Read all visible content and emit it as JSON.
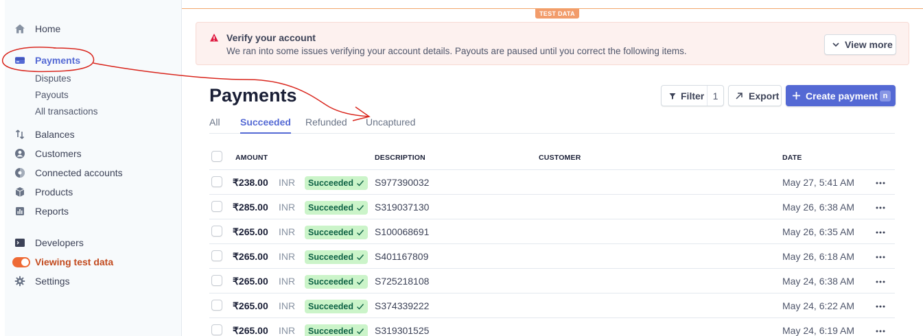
{
  "sidebar": {
    "items": [
      {
        "label": "Home",
        "icon": "home-icon"
      },
      {
        "label": "Payments",
        "icon": "payments-icon"
      },
      {
        "label": "Balances",
        "icon": "balances-icon"
      },
      {
        "label": "Customers",
        "icon": "customers-icon"
      },
      {
        "label": "Connected accounts",
        "icon": "connected-accounts-icon"
      },
      {
        "label": "Products",
        "icon": "products-icon"
      },
      {
        "label": "Reports",
        "icon": "reports-icon"
      },
      {
        "label": "Developers",
        "icon": "developers-icon"
      },
      {
        "label": "Viewing test data",
        "icon": "toggle-icon"
      },
      {
        "label": "Settings",
        "icon": "gear-icon"
      }
    ],
    "payments_sub": [
      "Disputes",
      "Payouts",
      "All transactions"
    ]
  },
  "test_badge": "TEST DATA",
  "alert": {
    "title": "Verify your account",
    "body": "We ran into some issues verifying your account details. Payouts are paused until you correct the following items.",
    "button": "View more"
  },
  "page": {
    "title": "Payments",
    "filter_label": "Filter",
    "filter_count": "1",
    "export_label": "Export",
    "create_label": "Create payment",
    "create_shortcut": "n"
  },
  "tabs": [
    "All",
    "Succeeded",
    "Refunded",
    "Uncaptured"
  ],
  "active_tab": "Succeeded",
  "table": {
    "headers": {
      "amount": "AMOUNT",
      "description": "DESCRIPTION",
      "customer": "CUSTOMER",
      "date": "DATE"
    },
    "rows": [
      {
        "amount": "₹238.00",
        "currency": "INR",
        "status": "Succeeded",
        "description": "S977390032",
        "customer": "",
        "date": "May 27, 5:41 AM"
      },
      {
        "amount": "₹285.00",
        "currency": "INR",
        "status": "Succeeded",
        "description": "S319037130",
        "customer": "",
        "date": "May 26, 6:38 AM"
      },
      {
        "amount": "₹265.00",
        "currency": "INR",
        "status": "Succeeded",
        "description": "S100068691",
        "customer": "",
        "date": "May 26, 6:35 AM"
      },
      {
        "amount": "₹265.00",
        "currency": "INR",
        "status": "Succeeded",
        "description": "S401167809",
        "customer": "",
        "date": "May 26, 6:18 AM"
      },
      {
        "amount": "₹265.00",
        "currency": "INR",
        "status": "Succeeded",
        "description": "S725218108",
        "customer": "",
        "date": "May 24, 6:38 AM"
      },
      {
        "amount": "₹265.00",
        "currency": "INR",
        "status": "Succeeded",
        "description": "S374339222",
        "customer": "",
        "date": "May 24, 6:22 AM"
      },
      {
        "amount": "₹265.00",
        "currency": "INR",
        "status": "Succeeded",
        "description": "S319301525",
        "customer": "",
        "date": "May 24, 6:19 AM"
      }
    ]
  },
  "colors": {
    "accent": "#5469d4",
    "test_orange": "#ee6a35",
    "success_bg": "#cbf4c9",
    "success_text": "#0e6245",
    "annotation_red": "#d9251c"
  }
}
